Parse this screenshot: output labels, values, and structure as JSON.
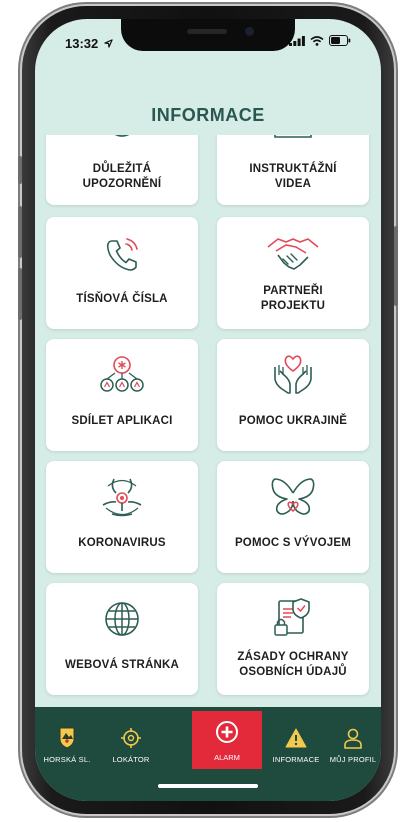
{
  "status_bar": {
    "time": "13:32"
  },
  "header": {
    "title": "INFORMACE"
  },
  "tiles": [
    {
      "label_line1": "DŮLEŽITÁ",
      "label_line2": "UPOZORNĚNÍ",
      "icon": "bell-icon"
    },
    {
      "label_line1": "INSTRUKTÁŽNÍ",
      "label_line2": "VIDEA",
      "icon": "video-icon"
    },
    {
      "label_line1": "TÍSŇOVÁ ČÍSLA",
      "label_line2": "",
      "icon": "phone-icon"
    },
    {
      "label_line1": "PARTNEŘI",
      "label_line2": "PROJEKTU",
      "icon": "handshake-icon"
    },
    {
      "label_line1": "SDÍLET APLIKACI",
      "label_line2": "",
      "icon": "share-network-icon"
    },
    {
      "label_line1": "POMOC UKRAJINĚ",
      "label_line2": "",
      "icon": "heart-hands-icon"
    },
    {
      "label_line1": "KORONAVIRUS",
      "label_line2": "",
      "icon": "biohazard-icon"
    },
    {
      "label_line1": "POMOC S VÝVOJEM",
      "label_line2": "",
      "icon": "butterfly-heart-icon"
    },
    {
      "label_line1": "WEBOVÁ STRÁNKA",
      "label_line2": "",
      "icon": "globe-icon"
    },
    {
      "label_line1": "ZÁSADY OCHRANY",
      "label_line2": "OSOBNÍCH ÚDAJŮ",
      "icon": "privacy-shield-icon"
    }
  ],
  "tabbar": {
    "items": [
      {
        "label": "HORSKÁ SL.",
        "icon": "mountain-rescue-badge-icon"
      },
      {
        "label": "LOKÁTOR",
        "icon": "crosshair-icon"
      },
      {
        "label": "ALARM",
        "icon": "plus-circle-icon"
      },
      {
        "label": "INFORMACE",
        "icon": "warning-triangle-icon"
      },
      {
        "label": "MŮJ PROFIL",
        "icon": "user-icon"
      }
    ]
  },
  "colors": {
    "background": "#d6ede7",
    "title": "#2a5750",
    "icon_accent": "#e24a57",
    "icon_stroke": "#2d5e54",
    "tabbar": "#1f4a3e",
    "alarm": "#e32a3b",
    "informace_active": "#f2c94c"
  }
}
